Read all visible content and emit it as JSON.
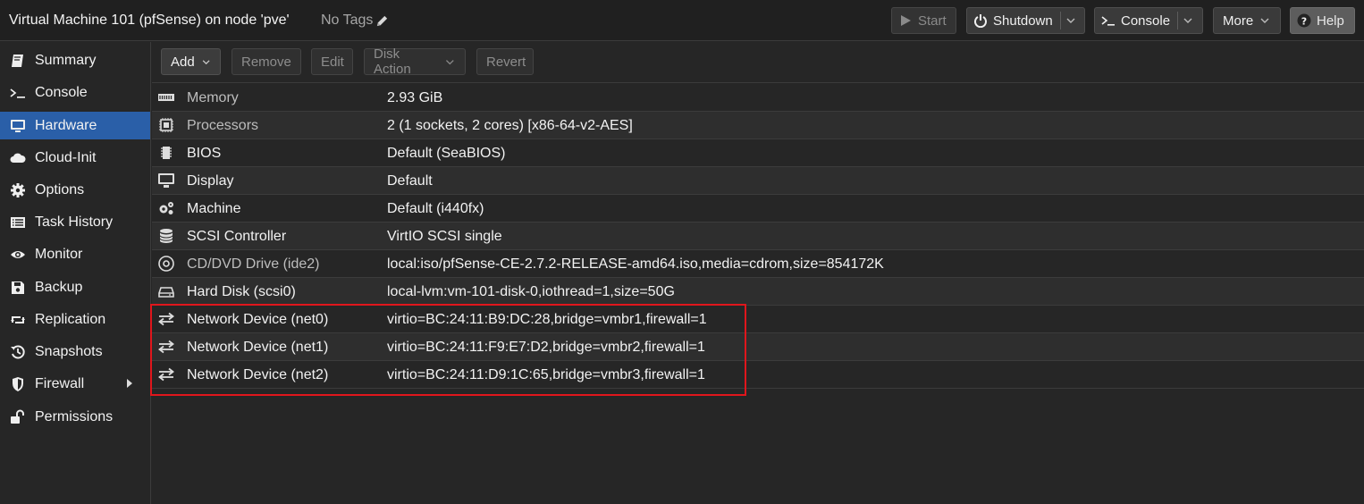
{
  "header": {
    "title": "Virtual Machine 101 (pfSense) on node 'pve'",
    "tags": "No Tags",
    "buttons": {
      "start": "Start",
      "shutdown": "Shutdown",
      "console": "Console",
      "more": "More",
      "help": "Help"
    }
  },
  "sidebar": {
    "items": [
      {
        "label": "Summary",
        "icon": "book-icon"
      },
      {
        "label": "Console",
        "icon": "terminal-icon"
      },
      {
        "label": "Hardware",
        "icon": "monitor-icon",
        "active": true
      },
      {
        "label": "Cloud-Init",
        "icon": "cloud-icon"
      },
      {
        "label": "Options",
        "icon": "gear-icon"
      },
      {
        "label": "Task History",
        "icon": "list-icon"
      },
      {
        "label": "Monitor",
        "icon": "eye-icon"
      },
      {
        "label": "Backup",
        "icon": "floppy-icon"
      },
      {
        "label": "Replication",
        "icon": "retweet-icon"
      },
      {
        "label": "Snapshots",
        "icon": "history-icon"
      },
      {
        "label": "Firewall",
        "icon": "shield-icon"
      },
      {
        "label": "Permissions",
        "icon": "unlock-icon"
      }
    ]
  },
  "toolbar": {
    "add": "Add",
    "remove": "Remove",
    "edit": "Edit",
    "disk_action": "Disk Action",
    "revert": "Revert"
  },
  "hardware": {
    "rows": [
      {
        "name": "Memory",
        "value": "2.93 GiB",
        "icon": "memory-icon"
      },
      {
        "name": "Processors",
        "value": "2 (1 sockets, 2 cores) [x86-64-v2-AES]",
        "icon": "cpu-icon"
      },
      {
        "name": "BIOS",
        "value": "Default (SeaBIOS)",
        "icon": "chip-icon"
      },
      {
        "name": "Display",
        "value": "Default",
        "icon": "desktop-icon"
      },
      {
        "name": "Machine",
        "value": "Default (i440fx)",
        "icon": "cogs-icon"
      },
      {
        "name": "SCSI Controller",
        "value": "VirtIO SCSI single",
        "icon": "database-icon"
      },
      {
        "name": "CD/DVD Drive (ide2)",
        "value": "local:iso/pfSense-CE-2.7.2-RELEASE-amd64.iso,media=cdrom,size=854172K",
        "icon": "cdrom-icon"
      },
      {
        "name": "Hard Disk (scsi0)",
        "value": "local-lvm:vm-101-disk-0,iothread=1,size=50G",
        "icon": "hdd-icon"
      },
      {
        "name": "Network Device (net0)",
        "value": "virtio=BC:24:11:B9:DC:28,bridge=vmbr1,firewall=1",
        "icon": "exchange-icon"
      },
      {
        "name": "Network Device (net1)",
        "value": "virtio=BC:24:11:F9:E7:D2,bridge=vmbr2,firewall=1",
        "icon": "exchange-icon"
      },
      {
        "name": "Network Device (net2)",
        "value": "virtio=BC:24:11:D9:1C:65,bridge=vmbr3,firewall=1",
        "icon": "exchange-icon"
      }
    ]
  },
  "colors": {
    "accent": "#2a5fa8",
    "highlight_border": "#e0161c",
    "background": "#262626"
  }
}
